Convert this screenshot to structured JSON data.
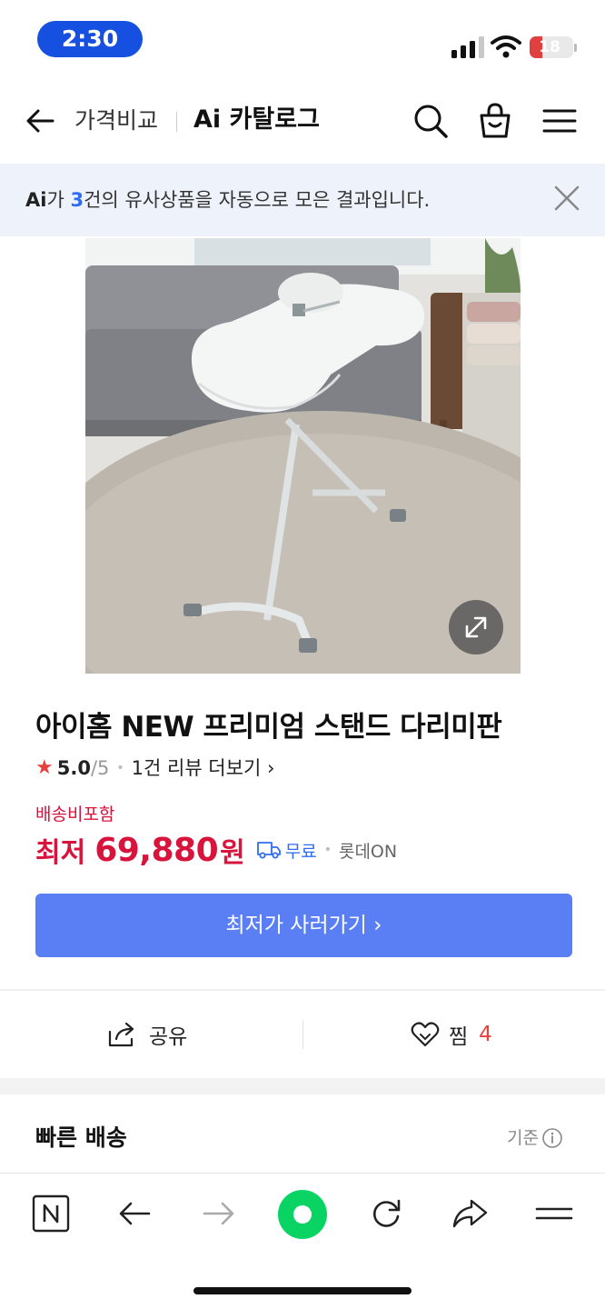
{
  "status_bar": {
    "time": "2:30",
    "battery": "18",
    "battery_level_percent": 18
  },
  "header": {
    "breadcrumb": "가격비교",
    "title": "Ai 카탈로그"
  },
  "ai_banner": {
    "logo": "Ai",
    "prefix": "가 ",
    "count": "3",
    "suffix": "건의 유사상품을 자동으로 모은 결과입니다."
  },
  "product": {
    "title": "아이홈 NEW 프리미엄 스탠드 다리미판",
    "rating": "5.0",
    "rating_max": "/5",
    "review_link": "1건 리뷰 더보기 ›",
    "delivery_included": "배송비포함",
    "price_label": "최저",
    "price": "69,880",
    "price_unit": "원",
    "shipping": "무료",
    "mall": "롯데ON",
    "cta": "최저가 사러가기 ›"
  },
  "actions": {
    "share": "공유",
    "like": "찜",
    "like_count": "4"
  },
  "section": {
    "title": "빠른 배송",
    "basis": "기준"
  },
  "colors": {
    "accent_red": "#d8143c",
    "cta_blue": "#5a7ff5",
    "naver_green": "#09d463",
    "ai_blue": "#2f6cf5"
  }
}
